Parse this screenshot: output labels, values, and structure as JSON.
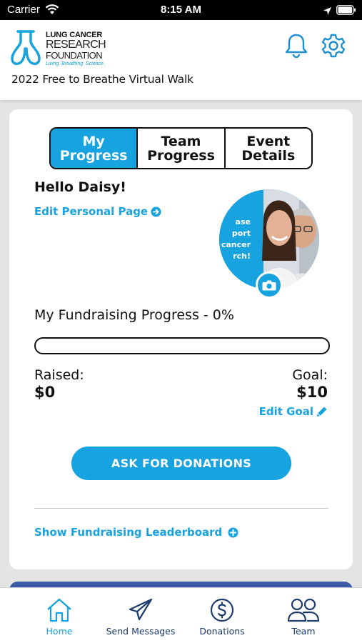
{
  "status_bar": {
    "carrier": "Carrier",
    "time": "8:15 AM"
  },
  "header": {
    "logo": {
      "line1": "LUNG CANCER",
      "line2": "RESEARCH",
      "line3": "FOUNDATION",
      "tagline": "Living. Breathing. Science."
    },
    "event_name": "2022 Free to Breathe Virtual Walk",
    "icons": [
      "bell-icon",
      "gear-icon"
    ]
  },
  "tabs": [
    {
      "label": "My Progress",
      "active": true
    },
    {
      "label": "Team Progress",
      "active": false
    },
    {
      "label": "Event Details",
      "active": false
    }
  ],
  "profile": {
    "greeting": "Hello Daisy!",
    "edit_page_link": "Edit Personal Page",
    "photo_sign_text": "ase port cancer rch!"
  },
  "fundraising": {
    "title": "My Fundraising Progress - 0%",
    "progress_fraction": 0,
    "raised_label": "Raised:",
    "raised_value": "$0",
    "goal_label": "Goal:",
    "goal_value": "$10",
    "edit_goal_link": "Edit Goal"
  },
  "ask_button": "ASK FOR DONATIONS",
  "leaderboard_link": "Show Fundraising Leaderboard",
  "tab_bar": [
    {
      "label": "Home",
      "icon": "home-icon",
      "active": true
    },
    {
      "label": "Send Messages",
      "icon": "paper-plane-icon",
      "active": false
    },
    {
      "label": "Donations",
      "icon": "dollar-circle-icon",
      "active": false
    },
    {
      "label": "Team",
      "icon": "people-icon",
      "active": false
    }
  ],
  "colors": {
    "accent": "#17a2e0",
    "nav_text": "#1e3c6e",
    "peek_card": "#3c5aa6"
  }
}
